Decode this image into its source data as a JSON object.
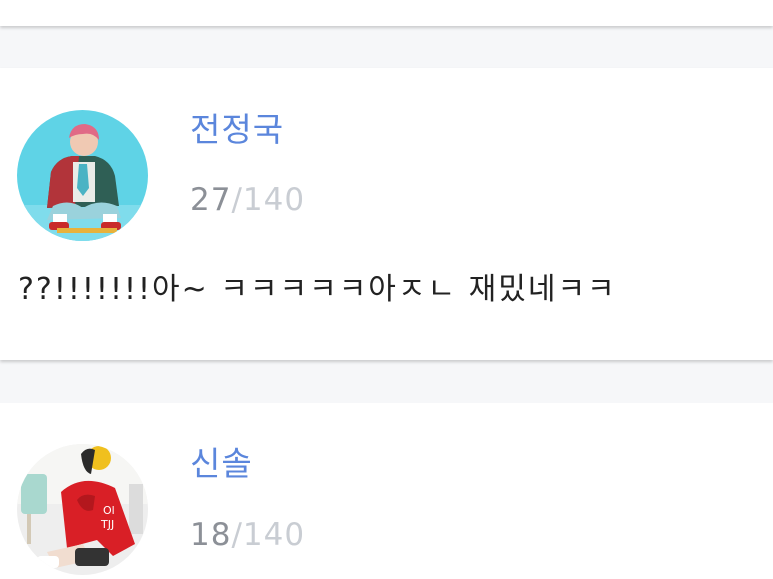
{
  "posts": [
    {
      "username": "전정국",
      "char_count": "27",
      "char_separator": "/",
      "char_limit": "140",
      "message": "??!!!!!!!아~ ㅋㅋㅋㅋㅋ아ㅈㄴ 재밌네ㅋㅋ"
    },
    {
      "username": "신솔",
      "char_count": "18",
      "char_separator": "/",
      "char_limit": "140"
    }
  ],
  "colors": {
    "username": "#5b86dc",
    "count_current": "#8c9097",
    "count_limit": "#c9cdd3",
    "background": "#f6f7f9"
  }
}
